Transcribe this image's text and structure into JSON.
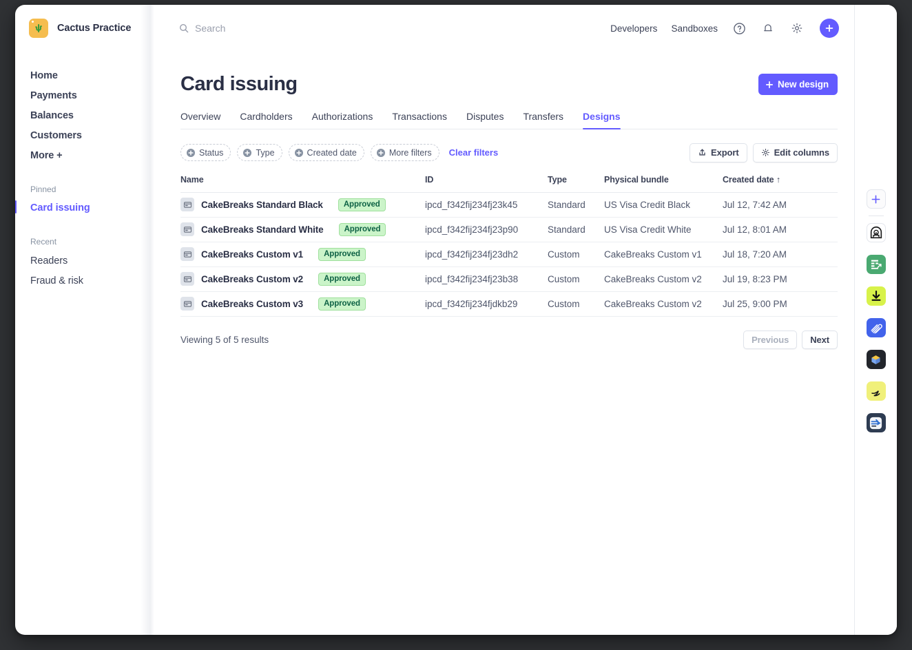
{
  "topbar": {
    "brand_name": "Cactus Practice",
    "logo_icon": "cactus-icon",
    "search_placeholder": "Search",
    "search_icon": "search-icon",
    "links": [
      {
        "label": "Developers",
        "name": "developers-link"
      },
      {
        "label": "Sandboxes",
        "name": "sandboxes-link"
      }
    ],
    "icons": [
      {
        "name": "help-icon"
      },
      {
        "name": "notifications-bell-icon"
      },
      {
        "name": "settings-gear-icon"
      }
    ],
    "create_button": {
      "name": "create-button",
      "icon": "plus-icon"
    }
  },
  "sidebar": {
    "items": [
      {
        "label": "Home"
      },
      {
        "label": "Payments"
      },
      {
        "label": "Balances"
      },
      {
        "label": "Customers"
      },
      {
        "label": "More +"
      }
    ],
    "pinned_label": "Pinned",
    "pinned": [
      {
        "label": "Card issuing",
        "active": true
      }
    ],
    "recent_label": "Recent",
    "recent": [
      {
        "label": "Readers"
      },
      {
        "label": "Fraud & risk"
      }
    ]
  },
  "page": {
    "title": "Card issuing",
    "new_design_label": "New design",
    "tabs": [
      {
        "label": "Overview",
        "active": false
      },
      {
        "label": "Cardholders",
        "active": false
      },
      {
        "label": "Authorizations",
        "active": false
      },
      {
        "label": "Transactions",
        "active": false
      },
      {
        "label": "Disputes",
        "active": false
      },
      {
        "label": "Transfers",
        "active": false
      },
      {
        "label": "Designs",
        "active": true
      }
    ]
  },
  "filters": {
    "pills": [
      {
        "label": "Status"
      },
      {
        "label": "Type"
      },
      {
        "label": "Created date"
      },
      {
        "label": "More filters"
      }
    ],
    "clear_label": "Clear filters",
    "export_label": "Export",
    "edit_columns_label": "Edit columns"
  },
  "table": {
    "columns": [
      "Name",
      "ID",
      "Type",
      "Physical bundle",
      "Created date"
    ],
    "sort_column": "Created date",
    "sort_indicator": "↑",
    "rows": [
      {
        "name": "CakeBreaks Standard Black",
        "status": "Approved",
        "id": "ipcd_f342fij234fj23k45",
        "type": "Standard",
        "bundle": "US Visa Credit Black",
        "created": "Jul 12, 7:42 AM"
      },
      {
        "name": "CakeBreaks Standard White",
        "status": "Approved",
        "id": "ipcd_f342fij234fj23p90",
        "type": "Standard",
        "bundle": "US Visa Credit White",
        "created": "Jul 12, 8:01 AM"
      },
      {
        "name": "CakeBreaks Custom v1",
        "status": "Approved",
        "id": "ipcd_f342fij234fj23dh2",
        "type": "Custom",
        "bundle": "CakeBreaks Custom v1",
        "created": "Jul 18, 7:20 AM"
      },
      {
        "name": "CakeBreaks Custom v2",
        "status": "Approved",
        "id": "ipcd_f342fij234fj23b38",
        "type": "Custom",
        "bundle": "CakeBreaks Custom v2",
        "created": "Jul 19, 8:23 PM"
      },
      {
        "name": "CakeBreaks Custom v3",
        "status": "Approved",
        "id": "ipcd_f342fij234fjdkb29",
        "type": "Custom",
        "bundle": "CakeBreaks Custom v2",
        "created": "Jul 25, 9:00 PM"
      }
    ]
  },
  "footer": {
    "results_text": "Viewing 5 of 5 results",
    "previous_label": "Previous",
    "next_label": "Next"
  },
  "dock": {
    "items": [
      {
        "name": "dock-add-app-icon"
      },
      {
        "name": "dock-arch-app-icon"
      },
      {
        "name": "dock-spreadsheet-app-icon"
      },
      {
        "name": "dock-download-app-icon"
      },
      {
        "name": "dock-fingerprint-app-icon"
      },
      {
        "name": "dock-cube-app-icon"
      },
      {
        "name": "dock-swoosh-app-icon"
      },
      {
        "name": "dock-arrow-app-icon"
      }
    ]
  },
  "colors": {
    "accent": "#635bff",
    "badge_bg": "#cbf4c9",
    "badge_text": "#0e6245",
    "logo_bg": "#f5bd4f",
    "text": "#3c4257"
  }
}
